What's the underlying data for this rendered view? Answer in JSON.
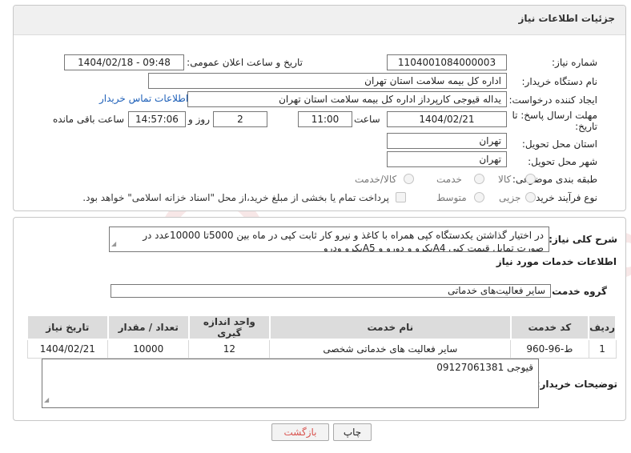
{
  "header": {
    "title": "جزئیات اطلاعات نیاز"
  },
  "fields": {
    "need_number_label": "شماره نیاز:",
    "need_number": "1104001084000003",
    "announce_label": "تاریخ و ساعت اعلان عمومی:",
    "announce_value": "1404/02/18 - 09:48",
    "buyer_org_label": "نام دستگاه خریدار:",
    "buyer_org": "اداره کل بیمه سلامت استان تهران",
    "creator_label": "ایجاد کننده درخواست:",
    "creator": "یداله قیوجی کارپرداز اداره کل بیمه سلامت استان تهران",
    "contact_link": "اطلاعات تماس خریدار",
    "deadline_label_1": "مهلت ارسال پاسخ: تا",
    "deadline_label_2": "تاریخ:",
    "deadline_date": "1404/02/21",
    "time_label": "ساعت",
    "deadline_time": "11:00",
    "days_value": "2",
    "days_label": "روز و",
    "remaining_time": "14:57:06",
    "remaining_label": "ساعت باقی مانده",
    "province_label": "استان محل تحویل:",
    "province": "تهران",
    "city_label": "شهر محل تحویل:",
    "city": "تهران",
    "category_label": "طبقه بندی موضوعی:",
    "category_options": [
      "کالا",
      "خدمت",
      "کالا/خدمت"
    ],
    "process_label": "نوع فرآیند خرید :",
    "process_options": [
      "جزیی",
      "متوسط"
    ],
    "payment_note": "پرداخت تمام یا بخشی از مبلغ خرید،از محل \"اسناد خزانه اسلامی\" خواهد بود."
  },
  "description": {
    "label": "شرح کلی نیاز:",
    "text": "در اختیار گذاشتن یکدستگاه کپی همراه با کاغذ و نیرو کار ثابت   کپی در ماه بین 5000تا 10000عدد در صورت تمایل قیمت کپی A4یکرو و دورو و A5یکرو ودرو"
  },
  "services": {
    "section_title": "اطلاعات خدمات مورد نیاز",
    "group_label": "گروه خدمت:",
    "group_value": "سایر فعالیت‌های خدماتی",
    "table": {
      "headers": [
        "ردیف",
        "کد خدمت",
        "نام خدمت",
        "واحد اندازه گیری",
        "تعداد / مقدار",
        "تاریخ نیاز"
      ],
      "rows": [
        [
          "1",
          "ط-96-960",
          "سایر فعالیت های خدماتی شخصی",
          "12",
          "10000",
          "1404/02/21"
        ]
      ]
    }
  },
  "buyer_notes": {
    "label": "توضیحات خریدار:",
    "text": "قیوجی 09127061381"
  },
  "buttons": {
    "print": "چاپ",
    "back": "بازگشت"
  },
  "colors": {
    "link": "#1d5fb8",
    "back_button_text": "#d9534f",
    "header_bg": "#f0f0f0"
  }
}
